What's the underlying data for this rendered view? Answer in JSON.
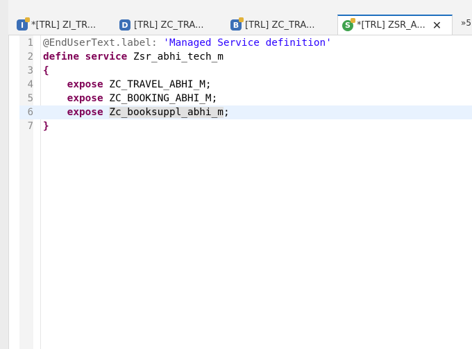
{
  "tabs": [
    {
      "label": "*[TRL] ZI_TR...",
      "icon": "interface-view-icon",
      "icon_glyph": "I",
      "active": false
    },
    {
      "label": "[TRL] ZC_TRA...",
      "icon": "data-definition-icon",
      "icon_glyph": "D",
      "active": false
    },
    {
      "label": "[TRL] ZC_TRA...",
      "icon": "behavior-definition-icon",
      "icon_glyph": "B",
      "active": false
    },
    {
      "label": "*[TRL] ZSR_A...",
      "icon": "service-definition-icon",
      "icon_glyph": "S",
      "active": true,
      "close": "✕"
    }
  ],
  "overflow_label": "»5",
  "editor": {
    "lines": [
      {
        "num": "1",
        "segments": [
          {
            "t": "@EndUserText.label: ",
            "c": "ann"
          },
          {
            "t": "'Managed Service definition'",
            "c": "str"
          }
        ]
      },
      {
        "num": "2",
        "segments": [
          {
            "t": "define",
            "c": "kw"
          },
          {
            "t": " ",
            "c": ""
          },
          {
            "t": "service",
            "c": "kw"
          },
          {
            "t": " Zsr_abhi_tech_m",
            "c": ""
          }
        ]
      },
      {
        "num": "3",
        "segments": [
          {
            "t": "{",
            "c": "kw"
          }
        ]
      },
      {
        "num": "4",
        "segments": [
          {
            "t": "    ",
            "c": ""
          },
          {
            "t": "expose",
            "c": "kw"
          },
          {
            "t": " ZC_TRAVEL_ABHI_M;",
            "c": ""
          }
        ]
      },
      {
        "num": "5",
        "segments": [
          {
            "t": "    ",
            "c": ""
          },
          {
            "t": "expose",
            "c": "kw"
          },
          {
            "t": " ZC_BOOKING_ABHI_M;",
            "c": ""
          }
        ]
      },
      {
        "num": "6",
        "current": true,
        "segments": [
          {
            "t": "    ",
            "c": ""
          },
          {
            "t": "expose",
            "c": "kw"
          },
          {
            "t": " ",
            "c": ""
          },
          {
            "t": "Zc_booksuppl_abhi_m",
            "c": "sel"
          },
          {
            "t": ";",
            "c": ""
          }
        ]
      },
      {
        "num": "7",
        "segments": [
          {
            "t": "}",
            "c": "kw"
          }
        ]
      }
    ]
  }
}
